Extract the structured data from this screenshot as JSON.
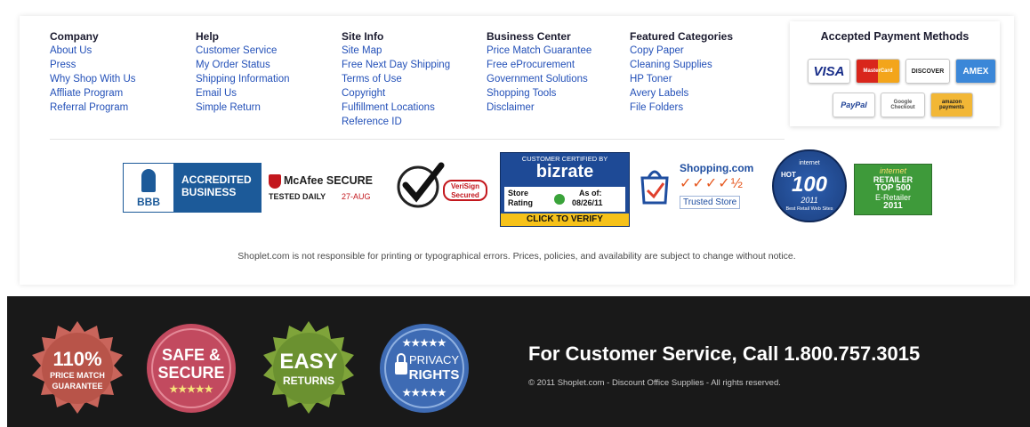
{
  "nav": {
    "company": {
      "title": "Company",
      "links": [
        "About Us",
        "Press",
        "Why Shop With Us",
        "Affliate Program",
        "Referral Program"
      ]
    },
    "help": {
      "title": "Help",
      "links": [
        "Customer Service",
        "My Order Status",
        "Shipping Information",
        "Email Us",
        "Simple Return"
      ]
    },
    "site_info": {
      "title": "Site Info",
      "links": [
        "Site Map",
        "Free Next Day Shipping",
        "Terms of Use",
        "Copyright",
        "Fulfillment Locations",
        "Reference ID"
      ]
    },
    "business_center": {
      "title": "Business Center",
      "links": [
        "Price Match Guarantee",
        "Free eProcurement",
        "Government Solutions",
        "Shopping Tools",
        "Disclaimer"
      ]
    },
    "featured": {
      "title": "Featured Categories",
      "links": [
        "Copy Paper",
        "Cleaning Supplies",
        "HP Toner",
        "Avery Labels",
        "File Folders"
      ]
    }
  },
  "payment": {
    "title": "Accepted Payment Methods",
    "cards": [
      "VISA",
      "MasterCard",
      "DISCOVER",
      "AMEX",
      "PayPal",
      "Google Checkout",
      "amazon payments"
    ]
  },
  "badges": {
    "bbb": {
      "logo": "BBB",
      "line1": "ACCREDITED",
      "line2": "BUSINESS"
    },
    "mcafee": {
      "name": "McAfee SECURE",
      "tested": "TESTED DAILY",
      "date": "27-AUG"
    },
    "verisign": {
      "line1": "VeriSign",
      "line2": "Secured"
    },
    "bizrate": {
      "top": "CUSTOMER CERTIFIED BY",
      "brand": "bizrate",
      "rating1": "Store",
      "rating2": "Rating",
      "asof": "As of:",
      "date": "08/26/11",
      "cta": "CLICK TO VERIFY"
    },
    "shopping": {
      "brand": "Shopping.com",
      "trusted": "Trusted Store"
    },
    "hot100": {
      "top": "internet",
      "hot": "HOT",
      "num": "100",
      "year": "2011",
      "sub": "Best Retail Web Sites"
    },
    "retailer": {
      "l1": "internet",
      "l2": "RETAILER",
      "l3": "TOP 500",
      "l4": "E-Retailer",
      "l5": "2011"
    }
  },
  "disclaimer": "Shoplet.com is not responsible for printing or typographical errors. Prices, policies, and availability are subject to change without notice.",
  "footer": {
    "seals": {
      "price": {
        "l1": "110%",
        "l2": "PRICE MATCH",
        "l3": "GUARANTEE"
      },
      "safe": {
        "l1": "SAFE &",
        "l2": "SECURE",
        "stars": "★★★★★"
      },
      "easy": {
        "l1": "EASY",
        "l2": "RETURNS"
      },
      "privacy": {
        "stars": "★★★★★",
        "l1": "PRIVACY",
        "l2": "RIGHTS"
      }
    },
    "phone": "For Customer Service, Call 1.800.757.3015",
    "copyright": "© 2011 Shoplet.com - Discount Office Supplies - All rights reserved."
  }
}
